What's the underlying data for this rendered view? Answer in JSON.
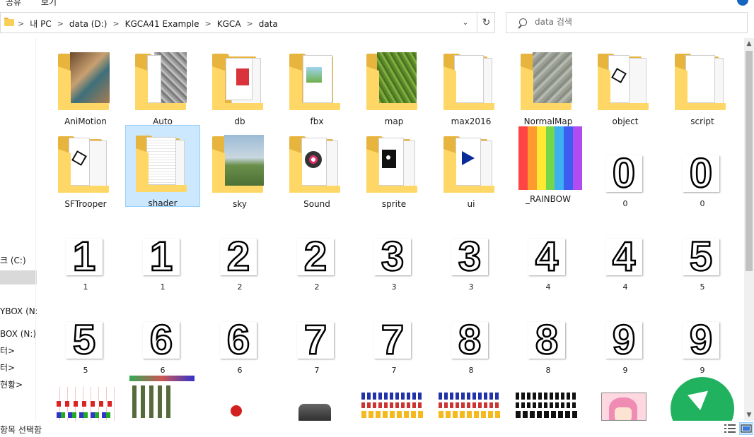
{
  "ribbon": {
    "left_fragment": "공유",
    "center_fragment": "보기"
  },
  "address_bar": {
    "crumbs": [
      "내 PC",
      "data (D:)",
      "KGCA41 Example",
      "KGCA",
      "data"
    ],
    "separator": ">"
  },
  "search": {
    "placeholder": "data 검색"
  },
  "nav": {
    "items": [
      {
        "label": "크 (C:)",
        "selected": false
      },
      {
        "label": "",
        "selected": true
      },
      {
        "label": "YBOX (N:",
        "selected": false
      },
      {
        "label": "BOX (N:)",
        "selected": false
      },
      {
        "label": "터>",
        "selected": false
      },
      {
        "label": "터>",
        "selected": false
      },
      {
        "label": "현황>",
        "selected": false
      }
    ]
  },
  "files": {
    "row1": [
      {
        "name": "AniMotion",
        "icon": "folder-image-icon"
      },
      {
        "name": "Auto",
        "icon": "folder-texture-icon"
      },
      {
        "name": "db",
        "icon": "folder-document-icon"
      },
      {
        "name": "fbx",
        "icon": "folder-image-icon"
      },
      {
        "name": "map",
        "icon": "folder-grass-icon"
      },
      {
        "name": "max2016",
        "icon": "folder-icon"
      },
      {
        "name": "NormalMap",
        "icon": "folder-texture-icon"
      },
      {
        "name": "object",
        "icon": "folder-cube-icon"
      },
      {
        "name": "script",
        "icon": "folder-icon"
      }
    ],
    "row2": [
      {
        "name": "SFTrooper",
        "icon": "folder-cube-icon"
      },
      {
        "name": "shader",
        "icon": "folder-icon",
        "selected": true
      },
      {
        "name": "sky",
        "icon": "folder-landscape-icon"
      },
      {
        "name": "Sound",
        "icon": "folder-media-icon"
      },
      {
        "name": "sprite",
        "icon": "folder-sprite-icon"
      },
      {
        "name": "ui",
        "icon": "folder-arrow-icon"
      },
      {
        "name": "_RAINBOW",
        "icon": "rainbow-image"
      },
      {
        "name": "0",
        "digit": "0"
      },
      {
        "name": "0",
        "digit": "0"
      }
    ],
    "row3": [
      {
        "name": "1",
        "digit": "1"
      },
      {
        "name": "1",
        "digit": "1"
      },
      {
        "name": "2",
        "digit": "2"
      },
      {
        "name": "2",
        "digit": "2"
      },
      {
        "name": "3",
        "digit": "3"
      },
      {
        "name": "3",
        "digit": "3"
      },
      {
        "name": "4",
        "digit": "4"
      },
      {
        "name": "4",
        "digit": "4"
      },
      {
        "name": "5",
        "digit": "5"
      }
    ],
    "row4": [
      {
        "name": "5",
        "digit": "5"
      },
      {
        "name": "6",
        "digit": "6"
      },
      {
        "name": "6",
        "digit": "6"
      },
      {
        "name": "7",
        "digit": "7"
      },
      {
        "name": "7",
        "digit": "7"
      },
      {
        "name": "8",
        "digit": "8"
      },
      {
        "name": "8",
        "digit": "8"
      },
      {
        "name": "9",
        "digit": "9"
      },
      {
        "name": "9",
        "digit": "9"
      }
    ]
  },
  "rainbow_colors": [
    "#ff4444",
    "#ff9a2e",
    "#ffe933",
    "#74d64a",
    "#3cb0f0",
    "#3c5ef0",
    "#b04cf0"
  ],
  "status_bar": {
    "text": "항목 선택함"
  },
  "colors": {
    "selection_bg": "#cce8ff",
    "selection_border": "#99d1ff",
    "folder": "#ffd766"
  }
}
